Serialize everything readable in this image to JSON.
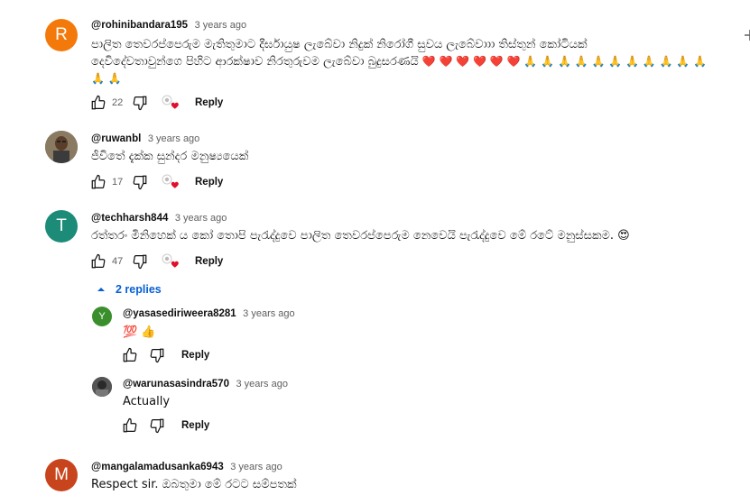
{
  "comments": [
    {
      "avatar_letter": "R",
      "avatar_color": "#f4790b",
      "handle": "@rohinibandara195",
      "time": "3 years ago",
      "text_line1": "පාලිත තෙවරප්පෙරුම මැතිතුමාට දීර්ඝායුෂ ලැබේවා නිදුක් නිරෝගී සුවය ලැබේවාාා තිස්තුන් කෝටියක්",
      "text_line2_main": "දෙවිදේවතාවුන්ගෙ පිහිට ආරක්ෂාව නිරතුරුවම ලැබේවා බුදුසරණයි",
      "text_line2_emoji": "❤️ ❤️ ❤️ ❤️ ❤️ ❤️ 🙏 🙏 🙏 🙏 🙏 🙏 🙏 🙏 🙏 🙏 🙏",
      "text_line3": "🙏 🙏",
      "likes": "22",
      "reply_label": "Reply"
    },
    {
      "avatar_letter": "",
      "avatar_color": "#6b5a47",
      "handle": "@ruwanbl",
      "time": "3 years ago",
      "text_line1": "ජීවිතේ දැක්ක සුන්දර මනුෂ්‍යයෙක්",
      "likes": "17",
      "reply_label": "Reply"
    },
    {
      "avatar_letter": "T",
      "avatar_color": "#1c8b78",
      "handle": "@techharsh844",
      "time": "3 years ago",
      "text_line1": "රත්තරං මිනිහෙක් ය කෝ තොපි පැරැද්දුවෙ පාලිත තෙවරප්පෙරුම නෙවෙයි පැරැද්දුවෙ මේ රටේ මනුස්සකම. 😍",
      "likes": "47",
      "reply_label": "Reply",
      "replies_toggle": "2 replies"
    },
    {
      "avatar_letter": "M",
      "avatar_color": "#c8441c",
      "handle": "@mangalamadusanka6943",
      "time": "3 years ago",
      "text_line1": "Respect sir. ඔබතුමා මේ රටට සම්පතක්"
    }
  ],
  "replies": [
    {
      "avatar_letter": "Y",
      "avatar_color": "#3a8f2c",
      "handle": "@yasasediriweera8281",
      "time": "3 years ago",
      "text": "💯 👍",
      "reply_label": "Reply"
    },
    {
      "avatar_letter": "",
      "avatar_color": "#4a4a4a",
      "handle": "@warunasasindra570",
      "time": "3 years ago",
      "text": "Actually",
      "reply_label": "Reply"
    }
  ]
}
